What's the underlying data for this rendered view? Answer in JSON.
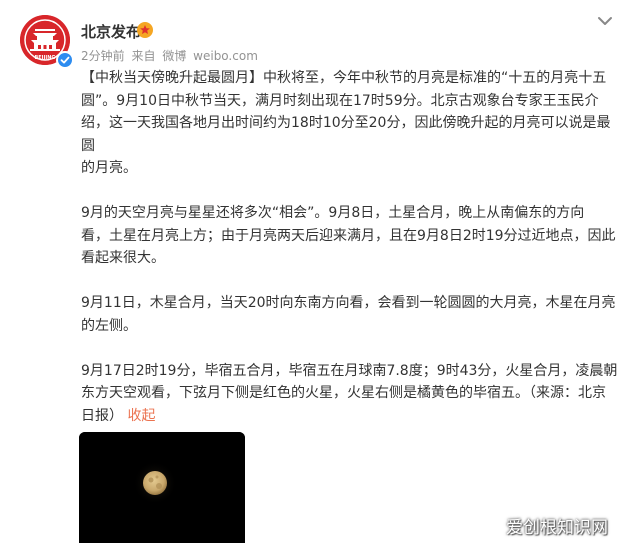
{
  "post": {
    "author": "北京发布",
    "meta": {
      "time": "2分钟前",
      "source_prefix": "来自",
      "source": "微博",
      "domain": "weibo.com"
    },
    "paragraphs": [
      "【中秋当天傍晚升起最圆月】中秋将至，今年中秋节的月亮是标准的“十五的月亮十五\n圆”。9月10日中秋节当天，满月时刻出现在17时59分。北京古观象台专家王玉民介\n绍，这一天我国各地月出时间约为18时10分至20分，因此傍晚升起的月亮可以说是最圆\n的月亮。",
      "9月的天空月亮与星星还将多次“相会”。9月8日，土星合月，晚上从南偏东的方向\n看，土星在月亮上方；由于月亮两天后迎来满月，且在9月8日2时19分过近地点，因此\n看起来很大。",
      "9月11日，木星合月，当天20时向东南方向看，会看到一轮圆圆的大月亮，木星在月亮\n的左侧。"
    ],
    "last_paragraph": "9月17日2时19分，毕宿五合月，毕宿五在月球南7.8度；9时43分，火星合月，凌晨朝\n东方天空观看，下弦月下侧是红色的火星，火星右侧是橘黄色的毕宿五。（来源：北京\n日报）",
    "fold_label": "收起"
  },
  "icons": {
    "avatar": "tiananmen-logo",
    "verified": "verified-check-icon",
    "badge": "gold-badge-icon",
    "menu": "chevron-down-icon"
  },
  "colors": {
    "avatar_red": "#d8262a",
    "verified_blue": "#2d8cf0",
    "link_orange": "#eb7350",
    "meta_gray": "#939393",
    "moon": "#c9a86c"
  },
  "watermark": "爱创根知识网"
}
